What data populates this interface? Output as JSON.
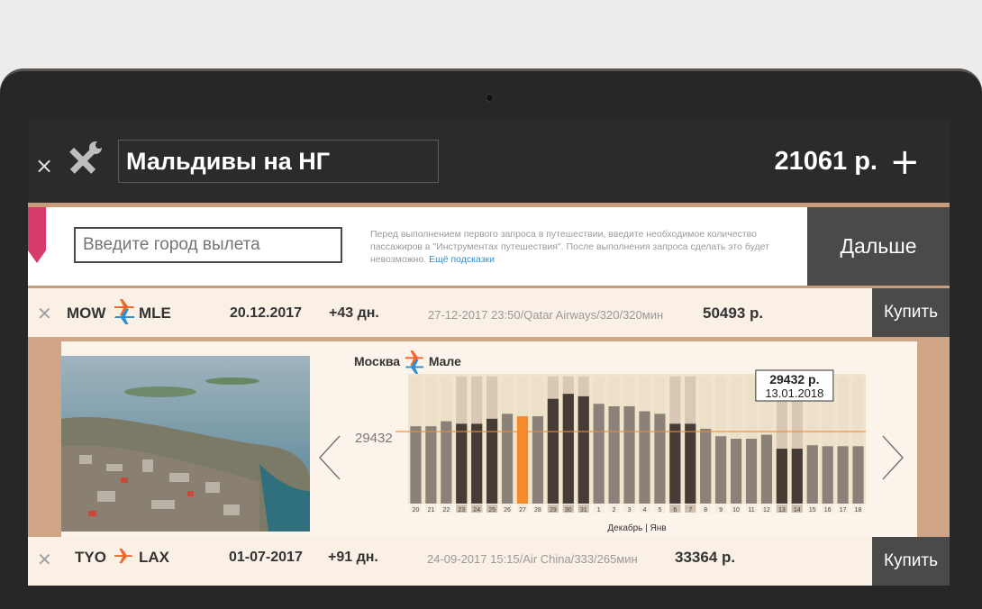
{
  "header": {
    "title": "Мальдивы на НГ",
    "total": "21061 р.",
    "plus_symbol": "+",
    "close_symbol": "×"
  },
  "city_input": {
    "placeholder": "Введите город вылета",
    "value": ""
  },
  "notice": {
    "text": "Перед выполнением первого запроса в путешествии, введите необходимое количество пассажиров в \"Инструментах путешествия\". После выполнения запроса сделать это будет невозможно.",
    "link": "Ещё подсказки"
  },
  "next_button": "Дальше",
  "trips": [
    {
      "from": "MOW",
      "to": "MLE",
      "date": "20.12.2017",
      "days": "+43 дн.",
      "flight": "27-12-2017 23:50/Qatar Airways/320/320мин",
      "price": "50493 р.",
      "buy_label": "Купить",
      "icon": "plane-roundtrip-icon"
    },
    {
      "from": "TYO",
      "to": "LAX",
      "date": "01-07-2017",
      "days": "+91 дн.",
      "flight": "24-09-2017 15:15/Air China/333/265мин",
      "price": "33364 р.",
      "buy_label": "Купить",
      "icon": "plane-oneway-icon"
    }
  ],
  "detail": {
    "route_from": "Москва",
    "route_to": "Мале",
    "tooltip_price": "29432 р.",
    "tooltip_date": "13.01.2018",
    "reference_label": "29432"
  },
  "colors": {
    "accent_orange": "#f0682d",
    "accent_blue": "#2e8fd3",
    "selected_bar": "#f7892b",
    "bookmark_pink": "#d83a6c",
    "dark_panel": "#4a4a4a"
  },
  "chart_data": {
    "type": "bar",
    "xlabel": "Декабрь | Янв",
    "categories": [
      "20",
      "21",
      "22",
      "23",
      "24",
      "25",
      "26",
      "27",
      "28",
      "29",
      "30",
      "31",
      "1",
      "2",
      "3",
      "4",
      "5",
      "6",
      "7",
      "8",
      "9",
      "10",
      "11",
      "12",
      "13",
      "14",
      "15",
      "16",
      "17",
      "18"
    ],
    "values": [
      30500,
      30500,
      31500,
      31000,
      31000,
      32000,
      33000,
      32500,
      32500,
      36000,
      37000,
      36500,
      35000,
      34500,
      34500,
      33500,
      33000,
      31000,
      31000,
      30000,
      28500,
      28000,
      28000,
      28800,
      26000,
      26000,
      26700,
      26500,
      26500,
      26500
    ],
    "shade_values": [
      40500,
      40500,
      40500,
      40500,
      40500,
      40500,
      40500,
      40500,
      40500,
      40500,
      40500,
      40500,
      40500,
      40500,
      40500,
      40500,
      40500,
      40500,
      40500,
      40500,
      40500,
      40500,
      40500,
      40500,
      40500,
      40500,
      40500,
      40500,
      40500,
      40500
    ],
    "dark_categories": [
      "23",
      "24",
      "25",
      "29",
      "30",
      "31",
      "6",
      "7",
      "13",
      "14"
    ],
    "highlight_categories": [
      "23",
      "24",
      "25",
      "29",
      "30",
      "31",
      "6",
      "7",
      "13",
      "14"
    ],
    "selected_category": "27",
    "reference_value": 29432,
    "ylim": [
      15000,
      41000
    ],
    "grid": false
  }
}
